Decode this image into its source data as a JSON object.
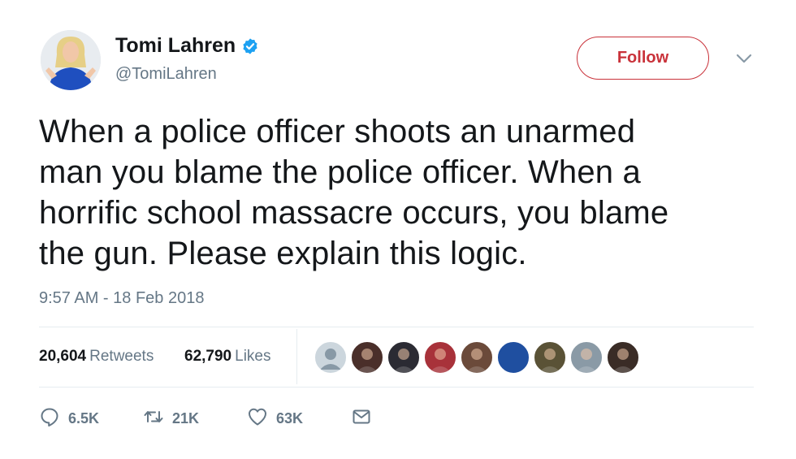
{
  "author": {
    "name": "Tomi Lahren",
    "handle": "@TomiLahren",
    "verified": true
  },
  "follow_label": "Follow",
  "tweet": {
    "lines": [
      "When a police officer shoots an unarmed",
      "man you blame the police officer. When a",
      "horrific school massacre occurs, you blame",
      "the gun. Please explain this logic."
    ],
    "timestamp": "9:57 AM - 18 Feb 2018"
  },
  "stats": {
    "retweets_count": "20,604",
    "retweets_label": "Retweets",
    "likes_count": "62,790",
    "likes_label": "Likes"
  },
  "actions": {
    "replies": "6.5K",
    "retweets": "21K",
    "likes": "63K"
  },
  "colors": {
    "follow_accent": "#c9323a",
    "verified_blue": "#1da1f2",
    "secondary_text": "#657786",
    "primary_text": "#14171a"
  },
  "liker_avatars": [
    {
      "icon": "default-profile-avatar",
      "color": "#ccd6dd"
    },
    {
      "icon": "woman-photo-avatar",
      "color": "#4a2f2a"
    },
    {
      "icon": "car-photo-avatar",
      "color": "#2b2b33"
    },
    {
      "icon": "group-photo-avatar",
      "color": "#a8323a"
    },
    {
      "icon": "event-photo-avatar",
      "color": "#6b4a3a"
    },
    {
      "icon": "blue-circle-avatar",
      "color": "#1f4fa0"
    },
    {
      "icon": "eagle-photo-avatar",
      "color": "#5a5236"
    },
    {
      "icon": "man-photo-avatar",
      "color": "#8a9aa6"
    },
    {
      "icon": "couple-photo-avatar",
      "color": "#3a2c26"
    }
  ]
}
